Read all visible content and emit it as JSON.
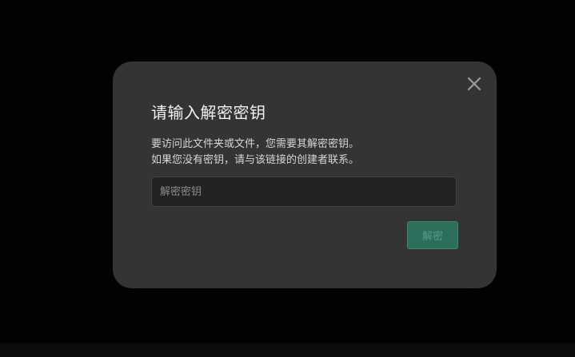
{
  "dialog": {
    "title": "请输入解密密钥",
    "description_line1": "要访问此文件夹或文件，您需要其解密密钥。",
    "description_line2": "如果您没有密钥，请与该链接的创建者联系。",
    "key_input": {
      "value": "",
      "placeholder": "解密密钥"
    },
    "decrypt_label": "解密",
    "close_icon": "close-icon"
  },
  "colors": {
    "dialog_bg": "#343434",
    "accent": "#2c6e59",
    "page_bg": "#000000"
  }
}
